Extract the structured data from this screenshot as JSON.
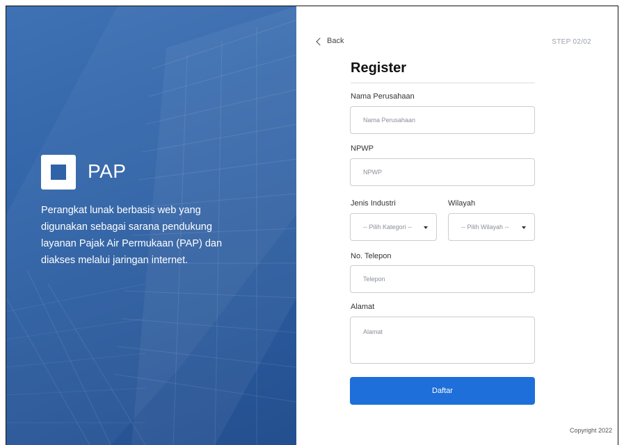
{
  "hero": {
    "brand": "PAP",
    "description": "Perangkat lunak berbasis web yang digunakan sebagai sarana pendukung layanan Pajak Air Permukaan (PAP) dan diakses melalui jaringan internet."
  },
  "nav": {
    "back_label": "Back",
    "step_label": "STEP 02/02"
  },
  "form": {
    "title": "Register",
    "company": {
      "label": "Nama Perusahaan",
      "placeholder": "Nama Perusahaan"
    },
    "npwp": {
      "label": "NPWP",
      "placeholder": "NPWP"
    },
    "industry": {
      "label": "Jenis Industri",
      "placeholder": "-- Pilih Kategori --"
    },
    "region": {
      "label": "Wilayah",
      "placeholder": "-- Pilih Wilayah --"
    },
    "phone": {
      "label": "No. Telepon",
      "placeholder": "Telepon"
    },
    "address": {
      "label": "Alamat",
      "placeholder": "Alamat"
    },
    "submit_label": "Daftar"
  },
  "footer": {
    "copyright": "Copyright 2022"
  },
  "colors": {
    "hero_blue": "#2f62a6",
    "primary_button": "#1e6fd9"
  }
}
